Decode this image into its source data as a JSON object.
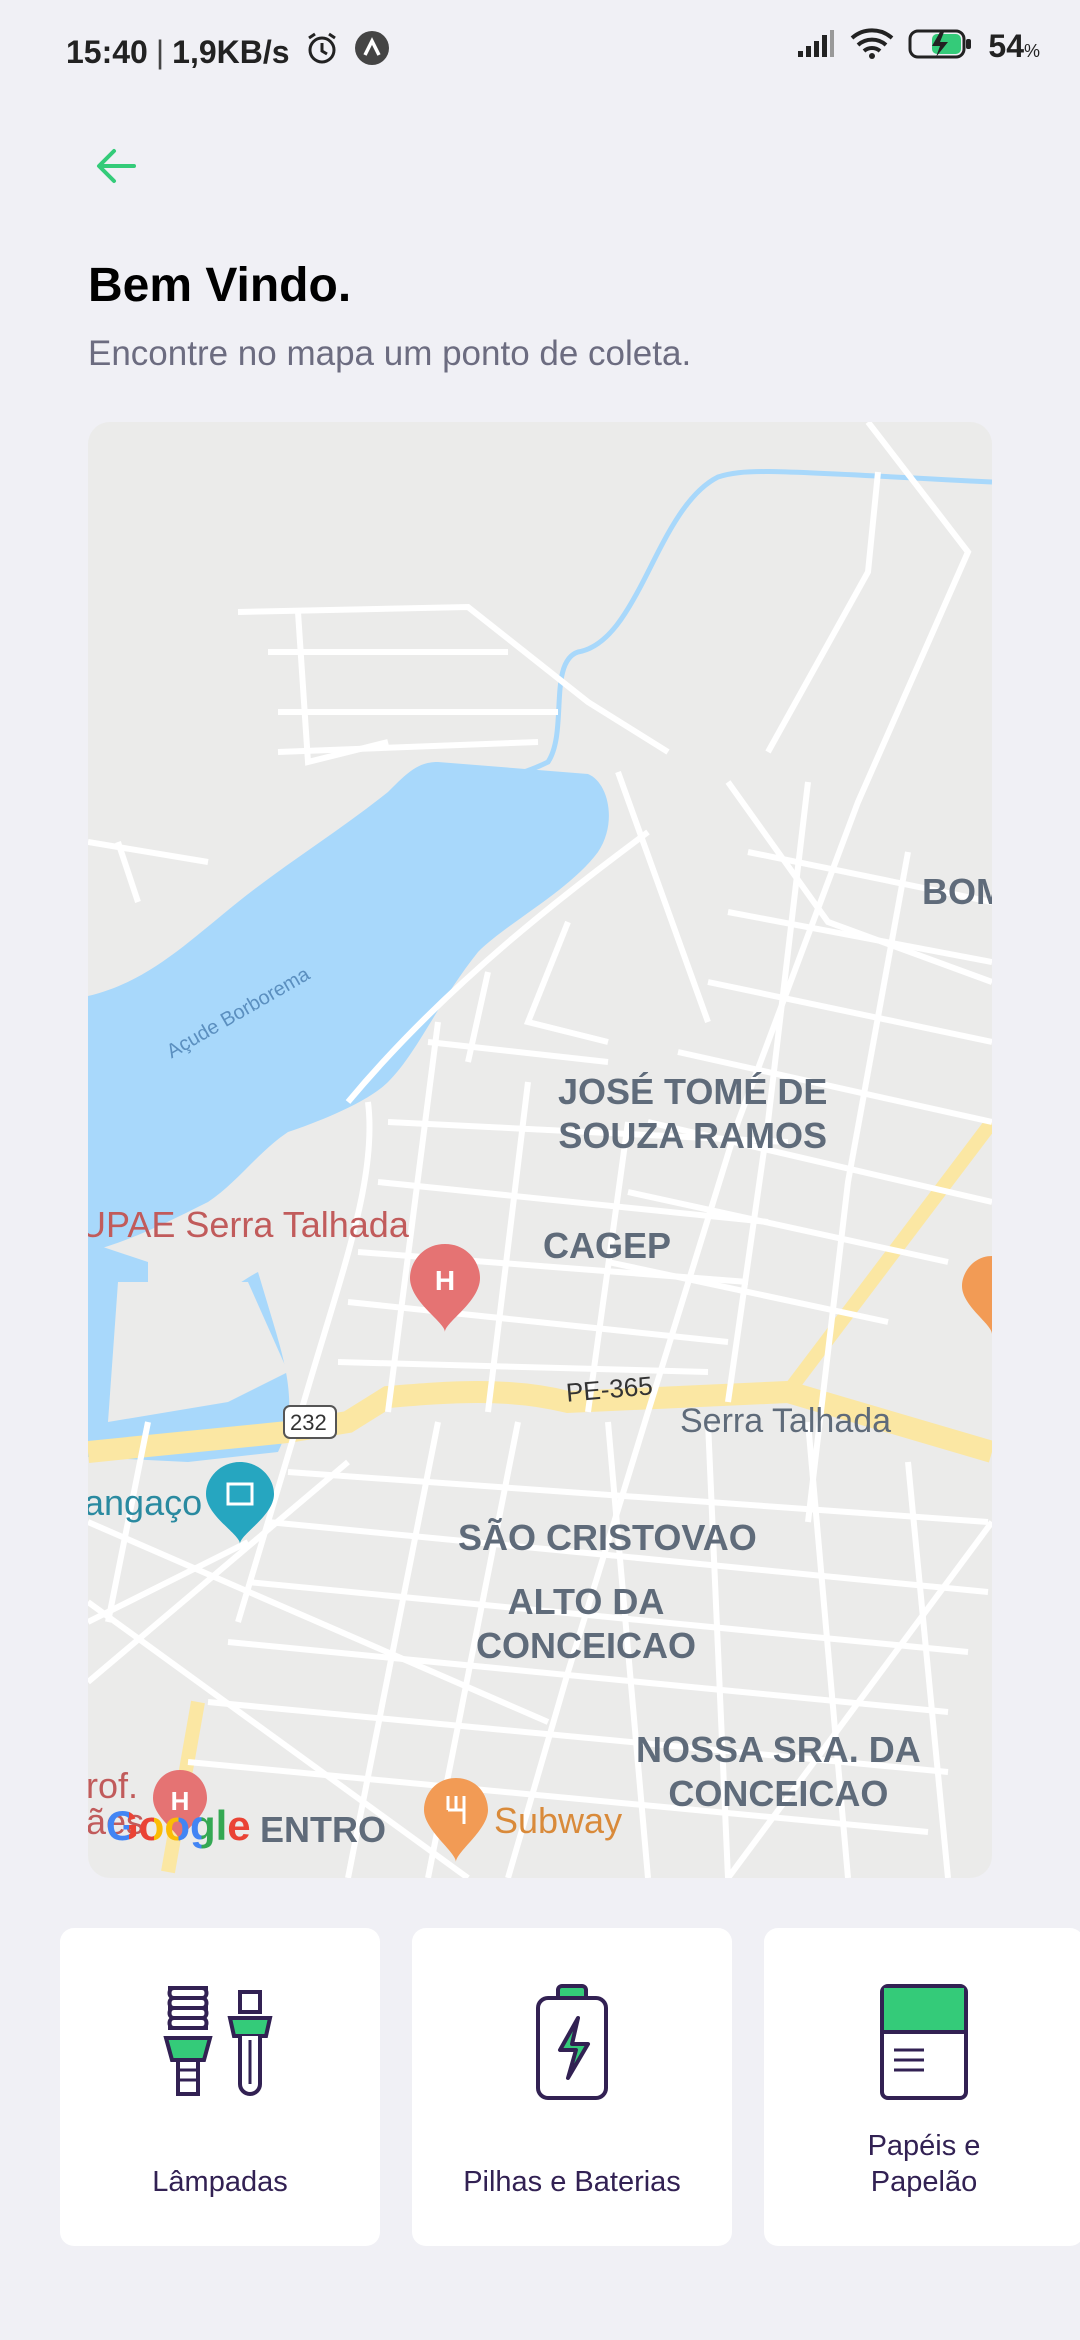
{
  "status_bar": {
    "time": "15:40",
    "separator": "|",
    "speed": "1,9KB/s",
    "battery_percent": "54",
    "battery_unit": "%"
  },
  "header": {
    "title": "Bem Vindo.",
    "subtitle": "Encontre no mapa um ponto de coleta."
  },
  "map": {
    "labels": {
      "reservoir": "Açude Borborema",
      "district_1a": "JOSÉ TOMÉ DE",
      "district_1b": "SOUZA RAMOS",
      "upae": "UPAE Serra Talhada",
      "cagep": "CAGEP",
      "road_pe": "PE-365",
      "road_232": "232",
      "city": "Serra Talhada",
      "cangaco": "angaço",
      "sao_cristovao": "SÃO CRISTOVAO",
      "alto_a": "ALTO DA",
      "alto_b": "CONCEICAO",
      "nossa_a": "NOSSA SRA. DA",
      "nossa_b": "CONCEICAO",
      "bom": "BOM",
      "centro": "ENTRO",
      "subway": "Subway",
      "prof_a": "rof.",
      "prof_b": "ães",
      "google": "Google"
    },
    "colors": {
      "water": "#a8d8fb",
      "land": "#ebebea",
      "road": "#ffffff",
      "highway": "#fbe7a3",
      "hospital": "#e57373",
      "restaurant": "#f29b55",
      "museum": "#26a6c0"
    }
  },
  "items": [
    {
      "label": "Lâmpadas",
      "icon": "lamps-icon"
    },
    {
      "label": "Pilhas e Baterias",
      "icon": "battery-icon"
    },
    {
      "label": "Papéis e\nPapelão",
      "icon": "paper-icon"
    }
  ],
  "accent_color": "#34cb79"
}
